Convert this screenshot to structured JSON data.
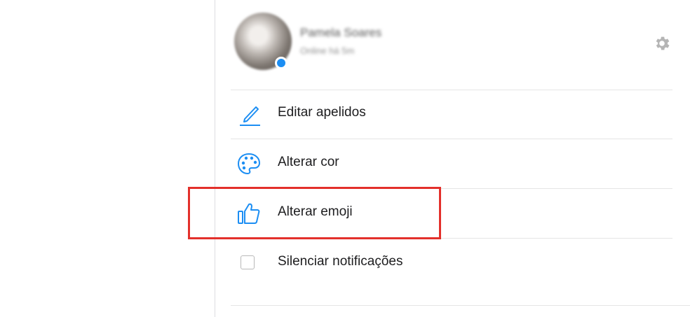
{
  "profile": {
    "name": "Pamela Soares",
    "status": "Online há 5m"
  },
  "menu": {
    "items": [
      {
        "label": "Editar apelidos",
        "icon": "pencil-icon"
      },
      {
        "label": "Alterar cor",
        "icon": "palette-icon"
      },
      {
        "label": "Alterar emoji",
        "icon": "thumbs-up-icon"
      },
      {
        "label": "Silenciar notificações",
        "icon": "checkbox"
      }
    ]
  },
  "colors": {
    "accent": "#1c8ef3",
    "highlight": "#e3302b"
  }
}
